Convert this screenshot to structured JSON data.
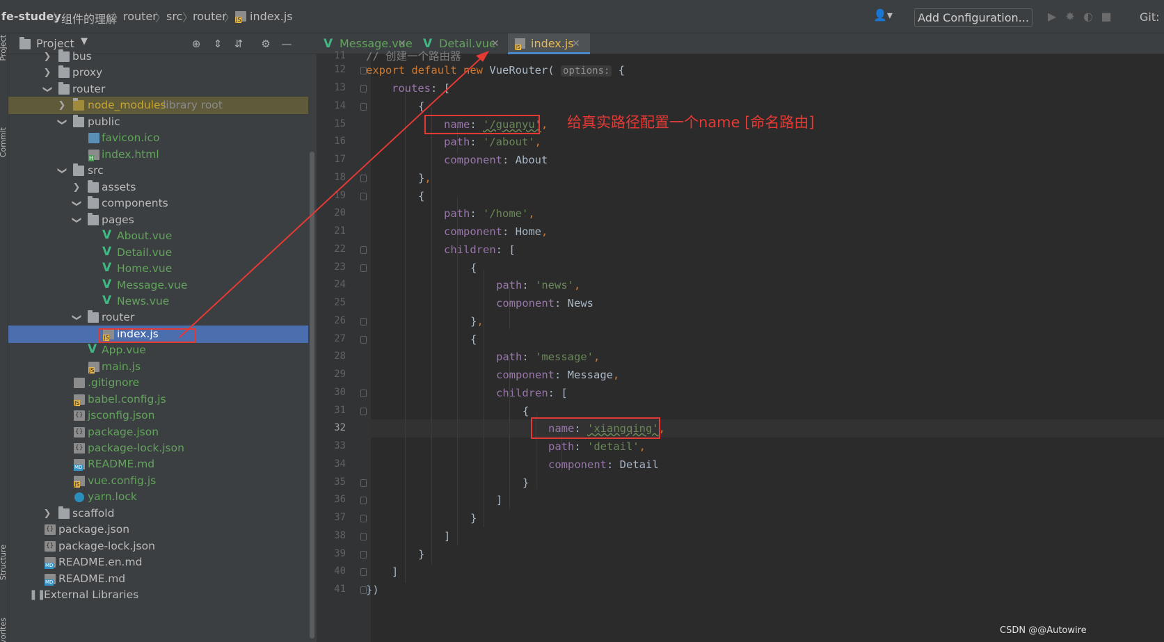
{
  "breadcrumb": [
    "fe-studey",
    "组件的理解",
    "router",
    "src",
    "router",
    "index.js"
  ],
  "toolbar": {
    "add_configuration": "Add Configuration...",
    "git": "Git:"
  },
  "tool_strip": {
    "project": "Project",
    "commit": "Commit",
    "structure": "Structure",
    "favorites": "Favorites"
  },
  "project_panel": {
    "title": "Project",
    "tree": [
      {
        "label": "bus",
        "hint": ""
      },
      {
        "label": "proxy",
        "hint": ""
      },
      {
        "label": "router",
        "hint": ""
      },
      {
        "label": "node_modules",
        "hint": "library root"
      },
      {
        "label": "public",
        "hint": ""
      },
      {
        "label": "favicon.ico",
        "hint": ""
      },
      {
        "label": "index.html",
        "hint": ""
      },
      {
        "label": "src",
        "hint": ""
      },
      {
        "label": "assets",
        "hint": ""
      },
      {
        "label": "components",
        "hint": ""
      },
      {
        "label": "pages",
        "hint": ""
      },
      {
        "label": "About.vue",
        "hint": ""
      },
      {
        "label": "Detail.vue",
        "hint": ""
      },
      {
        "label": "Home.vue",
        "hint": ""
      },
      {
        "label": "Message.vue",
        "hint": ""
      },
      {
        "label": "News.vue",
        "hint": ""
      },
      {
        "label": "router",
        "hint": ""
      },
      {
        "label": "index.js",
        "hint": ""
      },
      {
        "label": "App.vue",
        "hint": ""
      },
      {
        "label": "main.js",
        "hint": ""
      },
      {
        "label": ".gitignore",
        "hint": ""
      },
      {
        "label": "babel.config.js",
        "hint": ""
      },
      {
        "label": "jsconfig.json",
        "hint": ""
      },
      {
        "label": "package.json",
        "hint": ""
      },
      {
        "label": "package-lock.json",
        "hint": ""
      },
      {
        "label": "README.md",
        "hint": ""
      },
      {
        "label": "vue.config.js",
        "hint": ""
      },
      {
        "label": "yarn.lock",
        "hint": ""
      },
      {
        "label": "scaffold",
        "hint": ""
      },
      {
        "label": "package.json",
        "hint": ""
      },
      {
        "label": "package-lock.json",
        "hint": ""
      },
      {
        "label": "README.en.md",
        "hint": ""
      },
      {
        "label": "README.md",
        "hint": ""
      },
      {
        "label": "External Libraries",
        "hint": ""
      }
    ]
  },
  "tabs": [
    {
      "label": "Message.vue"
    },
    {
      "label": "Detail.vue"
    },
    {
      "label": "index.js"
    }
  ],
  "editor": {
    "line_numbers": [
      "11",
      "12",
      "13",
      "14",
      "15",
      "16",
      "17",
      "18",
      "19",
      "20",
      "21",
      "22",
      "23",
      "24",
      "25",
      "26",
      "27",
      "28",
      "29",
      "30",
      "31",
      "32",
      "33",
      "34",
      "35",
      "36",
      "37",
      "38",
      "39",
      "40",
      "41"
    ],
    "current_line": "32",
    "line11_comment": "// 创建一个路由器",
    "options_hint": "options:",
    "k_export": "export",
    "k_default": "default",
    "k_new": "new",
    "vuerouter": "VueRouter(",
    "routes": "routes",
    "name": "name",
    "path": "path",
    "component": "component",
    "children": "children",
    "s_guanyu": "'/guanyu'",
    "s_about": "'/about'",
    "about": "About",
    "s_home": "'/home'",
    "home": "Home",
    "s_news": "'news'",
    "news": "News",
    "s_message": "'message'",
    "message": "Message",
    "s_xiangqing": "'xiangqing'",
    "s_detail": "'detail'",
    "detail": "Detail"
  },
  "annotation": {
    "text": "给真实路径配置一个name [命名路由]",
    "color": "#e53935"
  },
  "watermark": "CSDN @@Autowire"
}
